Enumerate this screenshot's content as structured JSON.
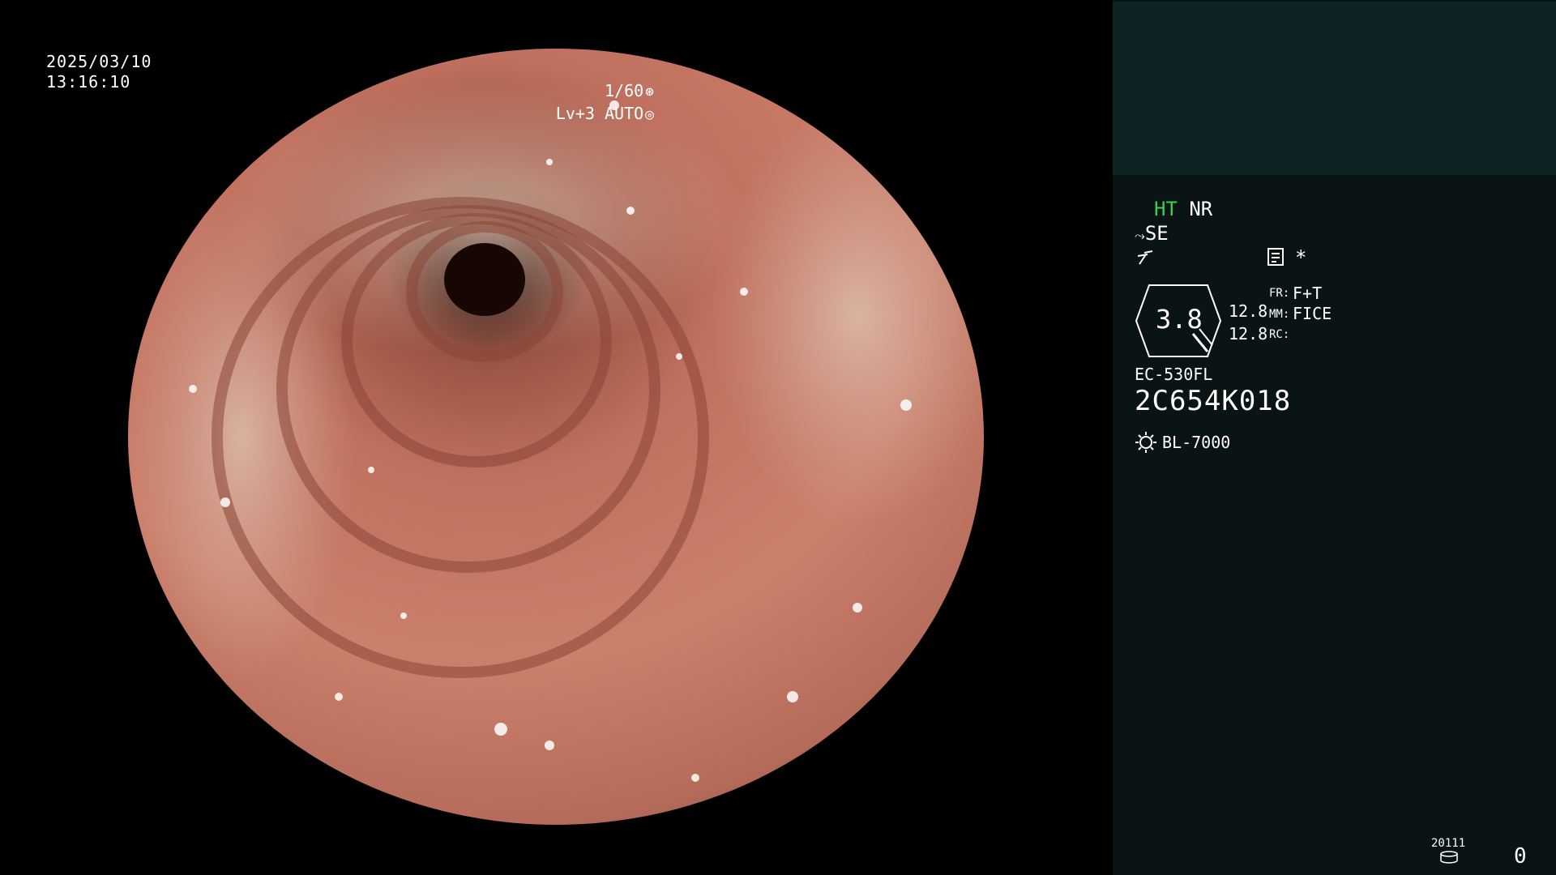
{
  "overlay": {
    "date": "2025/03/10",
    "time": "13:16:10",
    "shutter": "1/60",
    "shutter_icon": "aperture-icon",
    "level": "Lv+3 AUTO",
    "level_icon": "auto-iris-icon"
  },
  "panel": {
    "ht": "HT",
    "nr": "NR",
    "se": "SE",
    "se_icon": "structure-enhance-icon",
    "filter_icon": "filter-icon",
    "memo_icon": "memo-icon",
    "star": "*",
    "zoom_value": "3.8",
    "val1": "12.8",
    "val2": "12.8",
    "fr_label": "FR:",
    "fr_value": "F+T",
    "mm_label": "MM:",
    "mm_value": "FICE",
    "rc_label": "RC:",
    "scope_model": "EC-530FL",
    "serial": "2C654K018",
    "lamp_icon": "lamp-icon",
    "lamp": "BL-7000",
    "counter_id": "20111",
    "counter_value": "0"
  },
  "colors": {
    "ht_green": "#37d24a",
    "panel_bg": "#0a1414",
    "panel_top_bg": "#0e2424"
  }
}
